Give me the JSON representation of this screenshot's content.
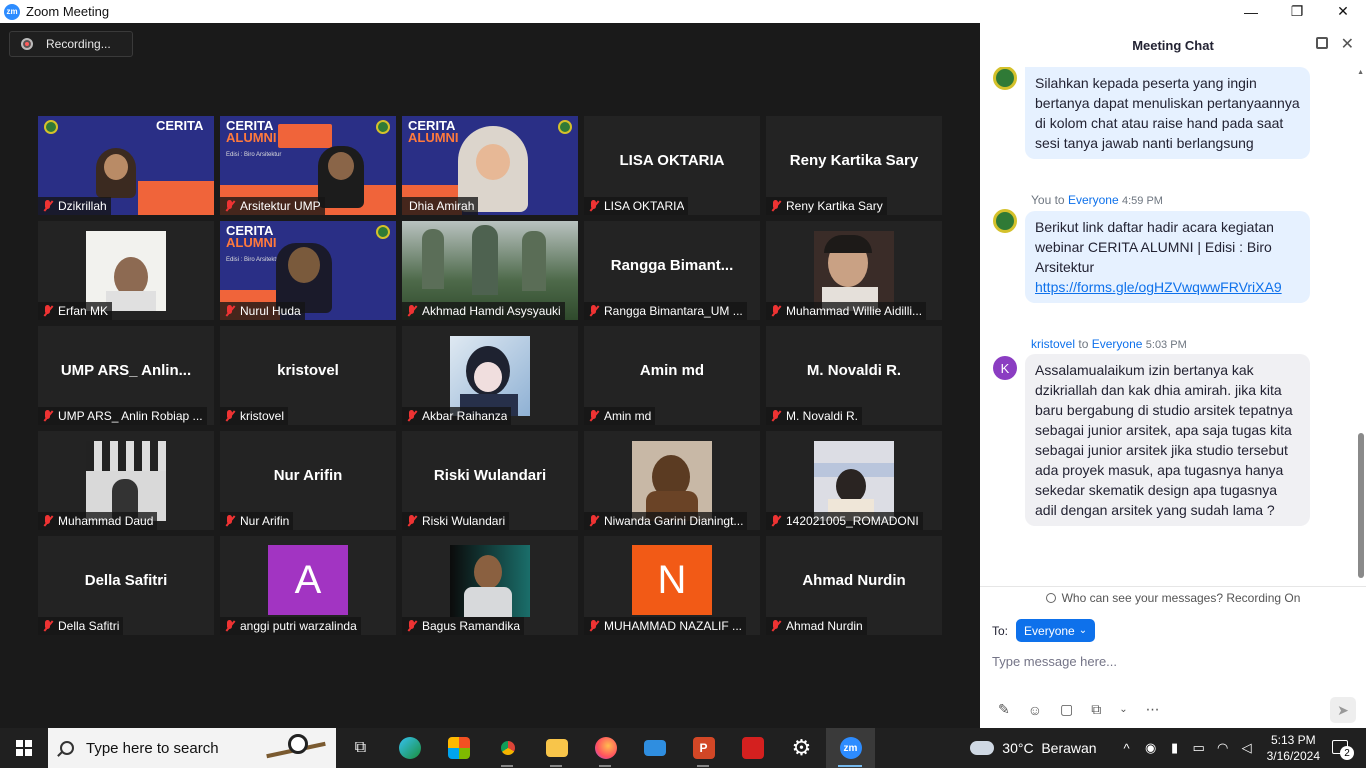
{
  "window": {
    "title": "Zoom Meeting",
    "minimize": "—",
    "maximize": "❐",
    "close": "✕"
  },
  "recording": {
    "label": "Recording..."
  },
  "participants": [
    {
      "name": "Dzikrillah"
    },
    {
      "name": "Arsitektur UMP"
    },
    {
      "name": "Dhia Amirah"
    },
    {
      "name": "LISA OKTARIA",
      "display": "LISA OKTARIA"
    },
    {
      "name": "Reny Kartika Sary",
      "display": "Reny Kartika Sary"
    },
    {
      "name": "Erfan MK"
    },
    {
      "name": "Nurul Huda"
    },
    {
      "name": "Akhmad Hamdi Asysyauki"
    },
    {
      "name": "Rangga Bimantara_UM ...",
      "display": "Rangga  Bimant..."
    },
    {
      "name": "Muhammad Willie Aidilli..."
    },
    {
      "name": "UMP ARS_ Anlin Robiap ...",
      "display": "UMP ARS_ Anlin..."
    },
    {
      "name": "kristovel",
      "display": "kristovel"
    },
    {
      "name": "Akbar Raihanza"
    },
    {
      "name": "Amin md",
      "display": "Amin md"
    },
    {
      "name": "M. Novaldi R.",
      "display": "M. Novaldi R."
    },
    {
      "name": "Muhammad Daud"
    },
    {
      "name": "Nur Arifin",
      "display": "Nur Arifin"
    },
    {
      "name": "Riski Wulandari",
      "display": "Riski Wulandari"
    },
    {
      "name": "Niwanda Garini Dianingt..."
    },
    {
      "name": "142021005_ROMADONI"
    },
    {
      "name": "Della Safitri",
      "display": "Della Safitri"
    },
    {
      "name": "anggi putri warzalinda",
      "avatar_letter": "A"
    },
    {
      "name": "Bagus Ramandika"
    },
    {
      "name": "MUHAMMAD NAZALIF ...",
      "avatar_letter": "N"
    },
    {
      "name": "Ahmad Nurdin",
      "display": "Ahmad Nurdin"
    }
  ],
  "banner": {
    "title": "CERITA",
    "subtitle": "ALUMNI",
    "edition": "Edisi : Biro Arsitektur"
  },
  "chat": {
    "title": "Meeting Chat",
    "messages": [
      {
        "text": "Silahkan kepada peserta yang ingin bertanya dapat menuliskan pertanyaannya di kolom chat atau raise hand pada saat sesi tanya jawab nanti berlangsung"
      },
      {
        "sender": "You",
        "to_word": "to",
        "recipient": "Everyone",
        "time": "4:59 PM",
        "text": "Berikut link daftar hadir acara kegiatan webinar CERITA ALUMNI | Edisi : Biro Arsitektur",
        "link": "https://forms.gle/ogHZVwqwwFRVriXA9"
      },
      {
        "sender": "kristovel",
        "to_word": "to",
        "recipient": "Everyone",
        "time": "5:03 PM",
        "avatar_letter": "K",
        "text": "Assalamualaikum izin bertanya kak dzikriallah dan kak dhia amirah. jika kita baru bergabung di studio arsitek tepatnya sebagai junior arsitek, apa saja tugas kita sebagai junior arsitek jika studio tersebut ada proyek masuk, apa tugasnya hanya sekedar skematik design apa tugasnya adil dengan arsitek yang sudah lama ?"
      }
    ],
    "who_can_see": "Who can see your messages? Recording On",
    "to_label": "To:",
    "to_value": "Everyone",
    "input_placeholder": "Type message here..."
  },
  "taskbar": {
    "search_placeholder": "Type here to search",
    "weather": "30°C  Berawan",
    "time": "5:13 PM",
    "date": "3/16/2024",
    "notifications": "2"
  }
}
